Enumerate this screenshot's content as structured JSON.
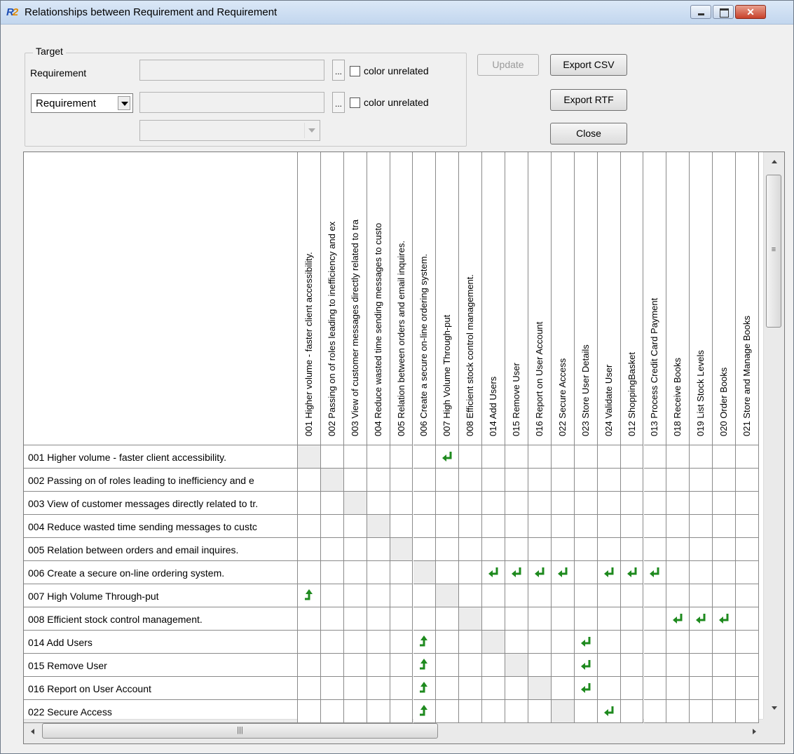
{
  "window": {
    "title": "Relationships between Requirement and Requirement"
  },
  "target": {
    "group_label": "Target",
    "row1_label": "Requirement",
    "row1_value": "",
    "color_unrelated": "color unrelated",
    "type_select_value": "Requirement",
    "row2_value": "",
    "row3_value": ""
  },
  "buttons": {
    "update": "Update",
    "export_csv": "Export CSV",
    "export_rtf": "Export RTF",
    "close": "Close"
  },
  "matrix": {
    "columns": [
      "001 Higher volume - faster client accessibility.",
      "002 Passing on of roles leading to inefficiency and ex",
      "003 View of customer messages directly related to tra",
      "004 Reduce wasted time sending messages to custo",
      "005 Relation between orders and  email inquires.",
      "006 Create a secure on-line ordering system.",
      "007 High Volume Through-put",
      "008 Efficient stock control management.",
      "014 Add Users",
      "015 Remove User",
      "016 Report on User Account",
      "022 Secure Access",
      "023 Store User Details",
      "024 Validate User",
      "012 ShoppingBasket",
      "013 Process Credit Card Payment",
      "018 Receive Books",
      "019 List Stock Levels",
      "020 Order Books",
      "021 Store and Manage Books"
    ],
    "rows": [
      "001 Higher volume - faster client accessibility.",
      "002 Passing on of roles leading to inefficiency and e",
      "003 View of customer messages directly related to tr.",
      "004 Reduce wasted time sending messages to custc",
      "005 Relation between orders and  email inquires.",
      "006 Create a secure on-line ordering system.",
      "007 High Volume Through-put",
      "008 Efficient stock control management.",
      "014 Add Users",
      "015 Remove User",
      "016 Report on User Account",
      "022 Secure Access"
    ],
    "diagonal": [
      [
        0,
        0
      ],
      [
        1,
        1
      ],
      [
        2,
        2
      ],
      [
        3,
        3
      ],
      [
        4,
        4
      ],
      [
        5,
        5
      ],
      [
        6,
        6
      ],
      [
        7,
        7
      ],
      [
        8,
        8
      ],
      [
        9,
        9
      ],
      [
        10,
        10
      ],
      [
        11,
        11
      ]
    ],
    "relations": [
      {
        "row": 0,
        "col": 6,
        "arrow": "left"
      },
      {
        "row": 5,
        "col": 8,
        "arrow": "left"
      },
      {
        "row": 5,
        "col": 9,
        "arrow": "left"
      },
      {
        "row": 5,
        "col": 10,
        "arrow": "left"
      },
      {
        "row": 5,
        "col": 11,
        "arrow": "left"
      },
      {
        "row": 5,
        "col": 13,
        "arrow": "left"
      },
      {
        "row": 5,
        "col": 14,
        "arrow": "left"
      },
      {
        "row": 5,
        "col": 15,
        "arrow": "left"
      },
      {
        "row": 6,
        "col": 0,
        "arrow": "up"
      },
      {
        "row": 7,
        "col": 16,
        "arrow": "left"
      },
      {
        "row": 7,
        "col": 17,
        "arrow": "left"
      },
      {
        "row": 7,
        "col": 18,
        "arrow": "left"
      },
      {
        "row": 8,
        "col": 5,
        "arrow": "up"
      },
      {
        "row": 8,
        "col": 12,
        "arrow": "left"
      },
      {
        "row": 9,
        "col": 5,
        "arrow": "up"
      },
      {
        "row": 9,
        "col": 12,
        "arrow": "left"
      },
      {
        "row": 10,
        "col": 5,
        "arrow": "up"
      },
      {
        "row": 10,
        "col": 12,
        "arrow": "left"
      },
      {
        "row": 11,
        "col": 5,
        "arrow": "up"
      },
      {
        "row": 11,
        "col": 13,
        "arrow": "left"
      }
    ],
    "arrow_color": "#1e8a1e"
  },
  "icons": {
    "relation_left": "return-arrow-icon",
    "relation_up": "turn-up-arrow-icon"
  }
}
